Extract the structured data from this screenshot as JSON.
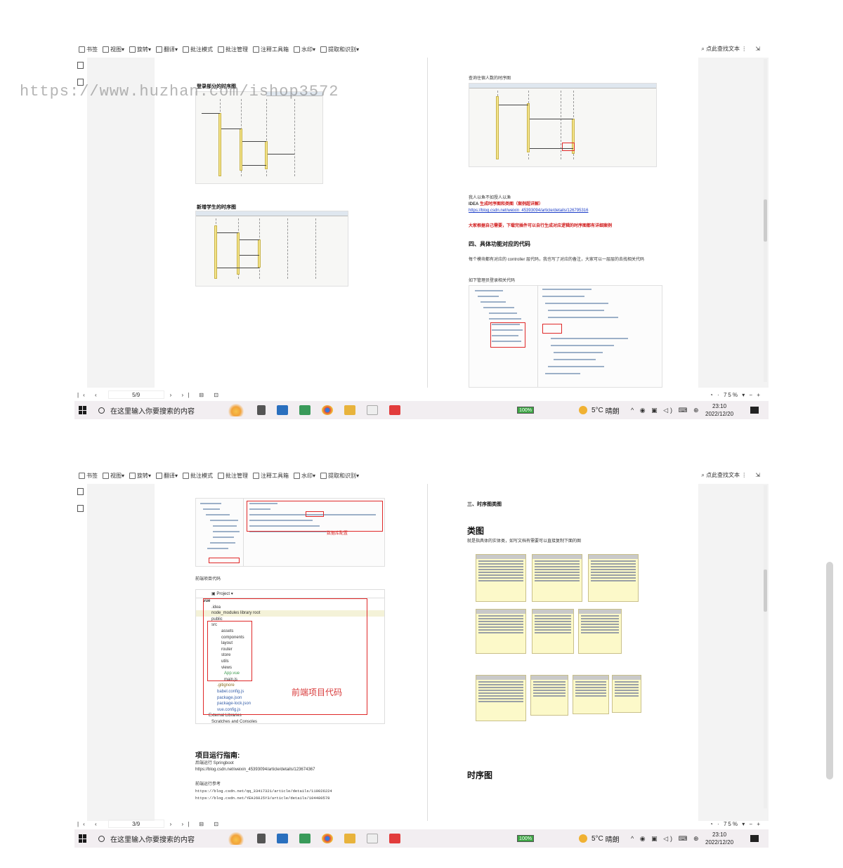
{
  "watermark": "https://www.huzhan.com/ishop3572",
  "toolbar": {
    "items": [
      "书签",
      "视图",
      "旋转",
      "翻译",
      "批注模式",
      "批注管理",
      "注释工具箱",
      "水印",
      "提取和识别"
    ],
    "find_label": "点此查找文本"
  },
  "taskbar": {
    "search_placeholder": "在这里输入你要搜索的内容",
    "battery": "100%",
    "temperature": "5°C",
    "weather": "晴朗",
    "time": "23:10",
    "date": "2022/12/20"
  },
  "screenshot1": {
    "page_number": "5/9",
    "zoom": "75%",
    "left_page": {
      "heading1": "登录部分的时序图",
      "heading2": "新增学生的时序图"
    },
    "right_page": {
      "caption": "查询住宿人数的时序图",
      "note": "我人以鱼不如授人以渔",
      "idea_prefix": "IDEA",
      "idea_title": "生成时序图和类图（案例超详解）",
      "link": "https://blog.csdn.net/weixin_45393094/article/details/126795316",
      "warning": "大家根据自己需要，下载完插件可以自行生成对应逻辑的时序图都有详细案例",
      "section_no": "四、",
      "section_title": "具体功能对应的代码",
      "body": "每个模块都有对应的 controller 层代码，我也写了对应的备注，大家可以一层层的去找相关代码",
      "code_caption": "如下管理员登录相关代码"
    }
  },
  "screenshot2": {
    "page_number": "3/9",
    "zoom": "75%",
    "left_page": {
      "db_label": "数据库配置",
      "frontend_caption": "前端项目代码",
      "project_label": "Project",
      "tree": [
        "vue",
        ".idea",
        "node_modules  library root",
        "public",
        "src",
        "assets",
        "components",
        "layout",
        "router",
        "store",
        "utils",
        "views",
        "App.vue",
        "main.js",
        ".gitignore",
        "babel.config.js",
        "package.json",
        "package-lock.json",
        "vue.config.js",
        "External Libraries",
        "Scratches and Consoles"
      ],
      "big_label": "前端项目代码",
      "guide_title": "项目运行指南:",
      "backend_label": "后端运行 Springboot",
      "backend_link": "https://blog.csdn.net/weixin_45393094/article/details/123674367",
      "frontend_ref": "前端运行参考",
      "frontend_link1": "https://blog.csdn.net/qq_33417321/article/details/119026224",
      "frontend_link2": "https://blog.csdn.net/YEHJ60J5Y3/article/details/104480578"
    },
    "right_page": {
      "section": "三、时序图类图",
      "class_title": "类图",
      "class_desc": "就是指具体的实体类，如写文档有需要可以直接复制下面的图",
      "seq_title": "时序图"
    }
  }
}
